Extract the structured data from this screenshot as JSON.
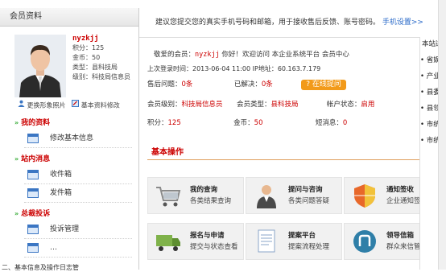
{
  "sidebar": {
    "header": "会员资料",
    "profile": {
      "username": "nyzkjj",
      "points": "积分：125",
      "gold": "金币：50",
      "type": "类型：县科技局",
      "level": "级别：科技局信息员"
    },
    "links": {
      "change_photo": "更换形象照片",
      "edit_info": "基本资料修改"
    },
    "sections": [
      {
        "title": "我的资料",
        "items": [
          "修改基本信息"
        ]
      },
      {
        "title": "站内消息",
        "items": [
          "收件箱",
          "发件箱"
        ]
      },
      {
        "title": "总裁投诉",
        "items": [
          "投诉管理",
          "…"
        ]
      }
    ]
  },
  "notice": {
    "text": "建议您提交您的真实手机号码和邮箱，用于接收售后反馈、账号密码。",
    "link": "手机设置>>"
  },
  "welcome": {
    "prefix": "敬爱的会员：",
    "username": "nyzkjj",
    "suffix": "你好！欢迎访问 本企业系统平台 会员中心"
  },
  "last_login": "上次登录时间：2013-06-04 11:00 IP地址：60.163.7.179",
  "stats": {
    "after_sale_label": "售后问题：",
    "after_sale_value": "0条",
    "resolved_label": "已解决：",
    "resolved_value": "0条",
    "online_button": "在线提问",
    "member_level_label": "会员级别：",
    "member_level_value": "科技局信息员",
    "member_type_label": "会员类型：",
    "member_type_value": "县科技局",
    "account_status_label": "帐户状态：",
    "account_status_value": "启用",
    "points_label": "积分：",
    "points_value": "125",
    "gold_label": "金币：",
    "gold_value": "50",
    "sms_label": "短消息：",
    "sms_value": "0"
  },
  "basic_ops": {
    "title": "基本操作",
    "tiles": [
      {
        "title": "我的查询",
        "sub": "各类结果查询",
        "icon": "shopping-cart-icon"
      },
      {
        "title": "提问与咨询",
        "sub": "各类问题答疑",
        "icon": "consult-people-icon"
      },
      {
        "title": "通知签收",
        "sub": "企业通知签收确认",
        "icon": "shield-icon"
      },
      {
        "title": "报名与申请",
        "sub": "提交与状态查看",
        "icon": "truck-icon"
      },
      {
        "title": "提案平台",
        "sub": "提案流程处理",
        "icon": "document-icon"
      },
      {
        "title": "领导信箱",
        "sub": "群众来信管理平台",
        "icon": "mailbox-icon"
      }
    ]
  },
  "right_panel": {
    "header": "本站通",
    "items": [
      "• 省娱",
      "• 产业",
      "• 县委",
      "• 县领",
      "• 市统",
      "• 市统"
    ]
  },
  "caption": "二、基本信息及操作日志管"
}
